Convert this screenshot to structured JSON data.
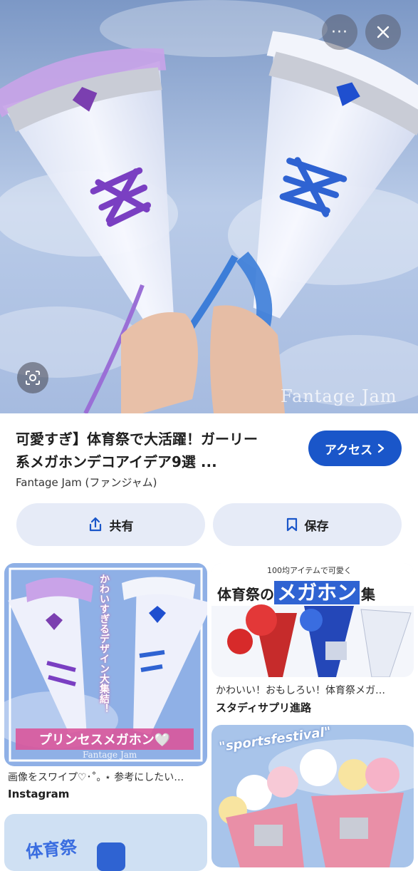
{
  "hero": {
    "watermark": "Fantage Jam",
    "more_label": "···"
  },
  "result": {
    "title_line1": "可愛すぎ】体育祭で大活躍！ガーリー",
    "title_line2": "系メガホンデコアイデア9選 ...",
    "source": "Fantage Jam (ファンジャム)",
    "access_label": "アクセス",
    "share_label": "共有",
    "save_label": "保存"
  },
  "cards": [
    {
      "overlay_vertical": "かわいすぎるデザイン大集結！",
      "overlay_banner": "プリンセスメガホン🤍",
      "watermark": "Fantage Jam",
      "caption": "画像をスワイプ♡･˚｡ ⋆ 参考にしたい…",
      "source": "Instagram"
    },
    {
      "overlay_top": "100均アイテムで可愛く",
      "overlay_title_a": "体育祭の",
      "overlay_title_b": "メガホン",
      "overlay_title_c": "集",
      "caption": "かわいい！おもしろい！体育祭メガ…",
      "source": "スタディサプリ進路"
    },
    {
      "overlay_text": "\"sportsfestival\""
    },
    {
      "overlay_text": "体育祭"
    }
  ],
  "colors": {
    "accent": "#1a56c9",
    "pill_bg": "#e6ebf7"
  }
}
